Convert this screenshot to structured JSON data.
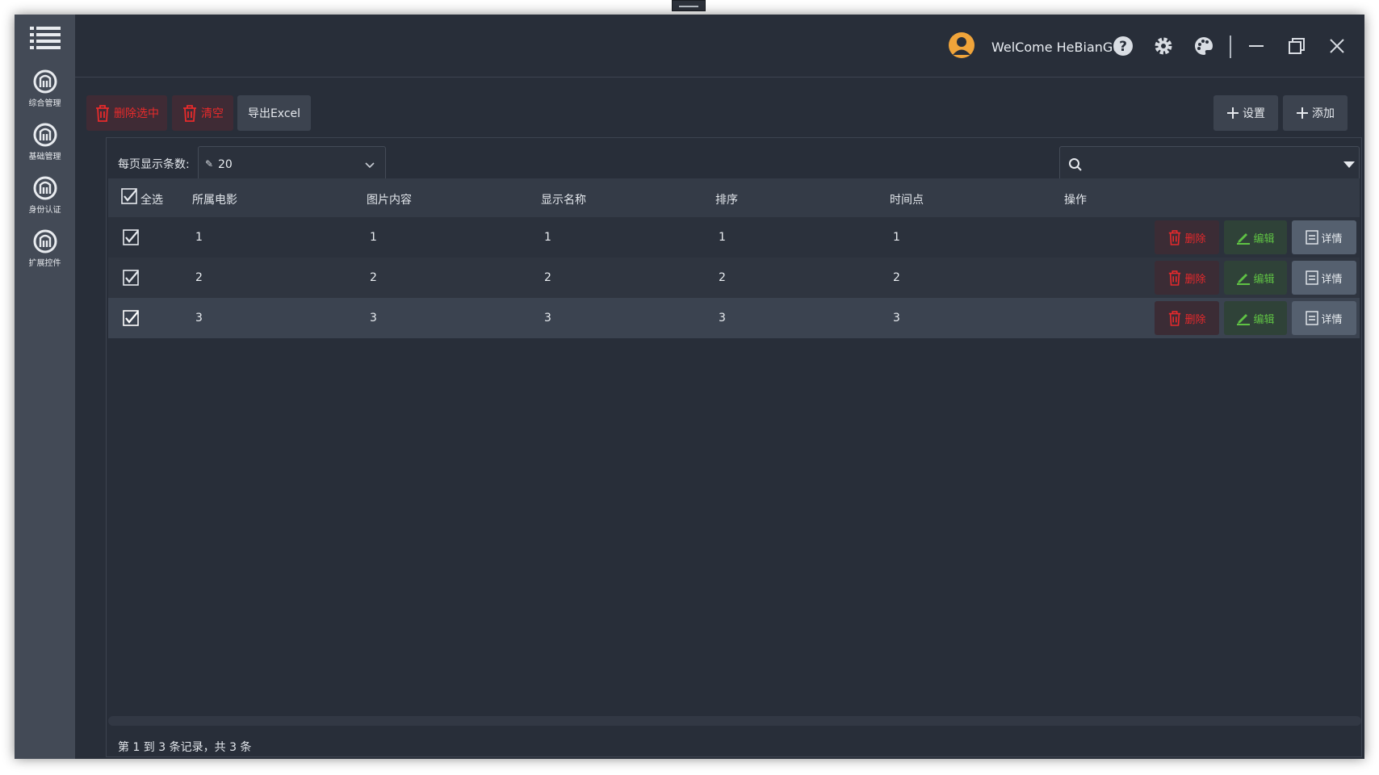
{
  "sidebar": {
    "items": [
      {
        "label": "综合管理",
        "icon": "logo-icon"
      },
      {
        "label": "基础管理",
        "icon": "logo-icon"
      },
      {
        "label": "身份认证",
        "icon": "logo-icon"
      },
      {
        "label": "扩展控件",
        "icon": "logo-icon"
      }
    ]
  },
  "header": {
    "welcome": "WelCome HeBianGu !"
  },
  "toolbar": {
    "delete_selected": "删除选中",
    "clear": "清空",
    "export_excel": "导出Excel",
    "settings": "设置",
    "add": "添加"
  },
  "pager": {
    "page_size_label": "每页显示条数:",
    "page_size_value": "20"
  },
  "search": {
    "placeholder": ""
  },
  "table": {
    "select_all_label": "全选",
    "columns": [
      "所属电影",
      "图片内容",
      "显示名称",
      "排序",
      "时间点",
      "操作"
    ],
    "rows": [
      {
        "cells": [
          "1",
          "1",
          "1",
          "1",
          "1"
        ],
        "checked": true
      },
      {
        "cells": [
          "2",
          "2",
          "2",
          "2",
          "2"
        ],
        "checked": true
      },
      {
        "cells": [
          "3",
          "3",
          "3",
          "3",
          "3"
        ],
        "checked": true
      }
    ],
    "actions": {
      "delete": "删除",
      "edit": "编辑",
      "detail": "详情"
    }
  },
  "footer": {
    "summary": "第 1 到 3 条记录，共 3 条"
  },
  "colors": {
    "background": "#282e39",
    "sidebar": "#434a56",
    "danger": "#e5292c",
    "success": "#5fc244",
    "avatar": "#f0a43a"
  }
}
